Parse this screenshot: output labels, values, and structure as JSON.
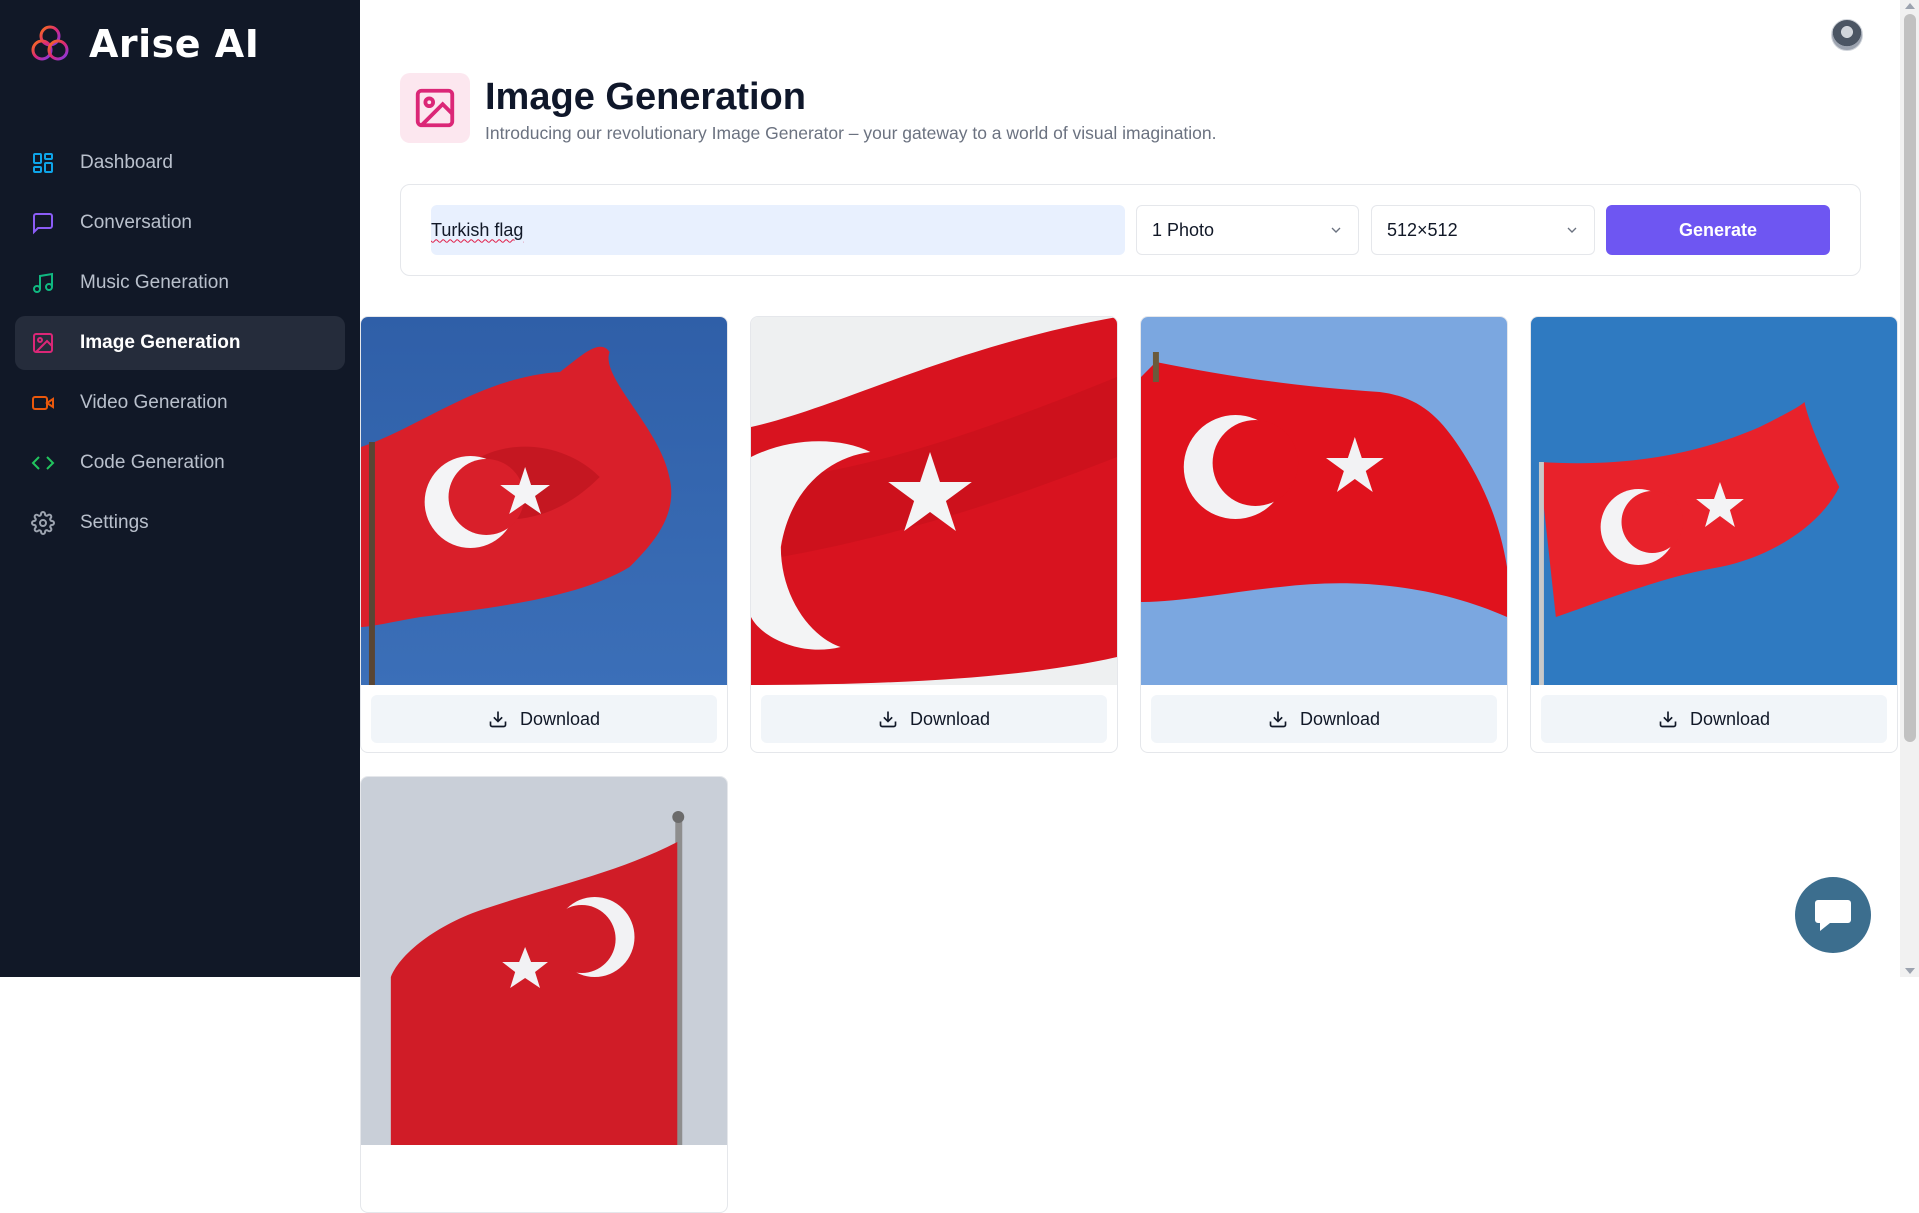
{
  "app": {
    "name": "Arise AI"
  },
  "sidebar": {
    "items": [
      {
        "label": "Dashboard",
        "icon": "dashboard-icon",
        "color": "#0ea5e9"
      },
      {
        "label": "Conversation",
        "icon": "message-square-icon",
        "color": "#8b5cf6"
      },
      {
        "label": "Music Generation",
        "icon": "music-icon",
        "color": "#10b981"
      },
      {
        "label": "Image Generation",
        "icon": "image-icon",
        "color": "#db2777",
        "active": true
      },
      {
        "label": "Video Generation",
        "icon": "video-icon",
        "color": "#ea580c"
      },
      {
        "label": "Code Generation",
        "icon": "code-icon",
        "color": "#22c55e"
      },
      {
        "label": "Settings",
        "icon": "gear-icon",
        "color": "#9ca3af"
      }
    ]
  },
  "header": {
    "title": "Image Generation",
    "subtitle": "Introducing our revolutionary Image Generator – your gateway to a world of visual imagination."
  },
  "form": {
    "prompt_value": "Turkish flag",
    "count_selected": "1 Photo",
    "size_selected": "512×512",
    "generate_label": "Generate"
  },
  "results": {
    "download_label": "Download",
    "images": [
      {
        "alt": "Turkish flag waving against blue sky"
      },
      {
        "alt": "Close-up of Turkish flag"
      },
      {
        "alt": "Turkish flag against light blue sky"
      },
      {
        "alt": "Turkish flag on pole against blue sky"
      },
      {
        "alt": "Turkish flag on tall pole against pale sky"
      }
    ]
  },
  "colors": {
    "sidebar_bg": "#111827",
    "accent": "#6e56f2",
    "flag_red": "#e30a17"
  }
}
